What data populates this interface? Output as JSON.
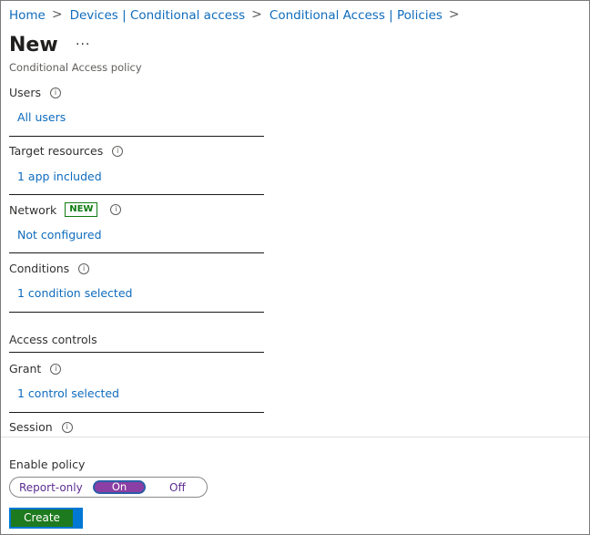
{
  "breadcrumb": {
    "items": [
      "Home",
      "Devices | Conditional access",
      "Conditional Access | Policies"
    ],
    "separator": ">"
  },
  "page": {
    "title": "New",
    "more_label": "···",
    "subtitle": "Conditional Access policy"
  },
  "info_glyph": "i",
  "assignments": {
    "users": {
      "label": "Users",
      "value": "All users"
    },
    "target_resources": {
      "label": "Target resources",
      "value": "1 app included"
    },
    "network": {
      "label": "Network",
      "badge": "NEW",
      "value": "Not configured"
    },
    "conditions": {
      "label": "Conditions",
      "value": "1 condition selected"
    }
  },
  "access_controls": {
    "heading": "Access controls",
    "grant": {
      "label": "Grant",
      "value": "1 control selected"
    },
    "session": {
      "label": "Session"
    }
  },
  "enable_policy": {
    "label": "Enable policy",
    "options": [
      "Report-only",
      "On",
      "Off"
    ],
    "selected": "On"
  },
  "actions": {
    "create_label": "Create"
  },
  "colors": {
    "link": "#0f6cbd",
    "badge_green": "#107c10",
    "toggle_selected": "#8b3ea3",
    "primary_button": "#0078d4"
  }
}
